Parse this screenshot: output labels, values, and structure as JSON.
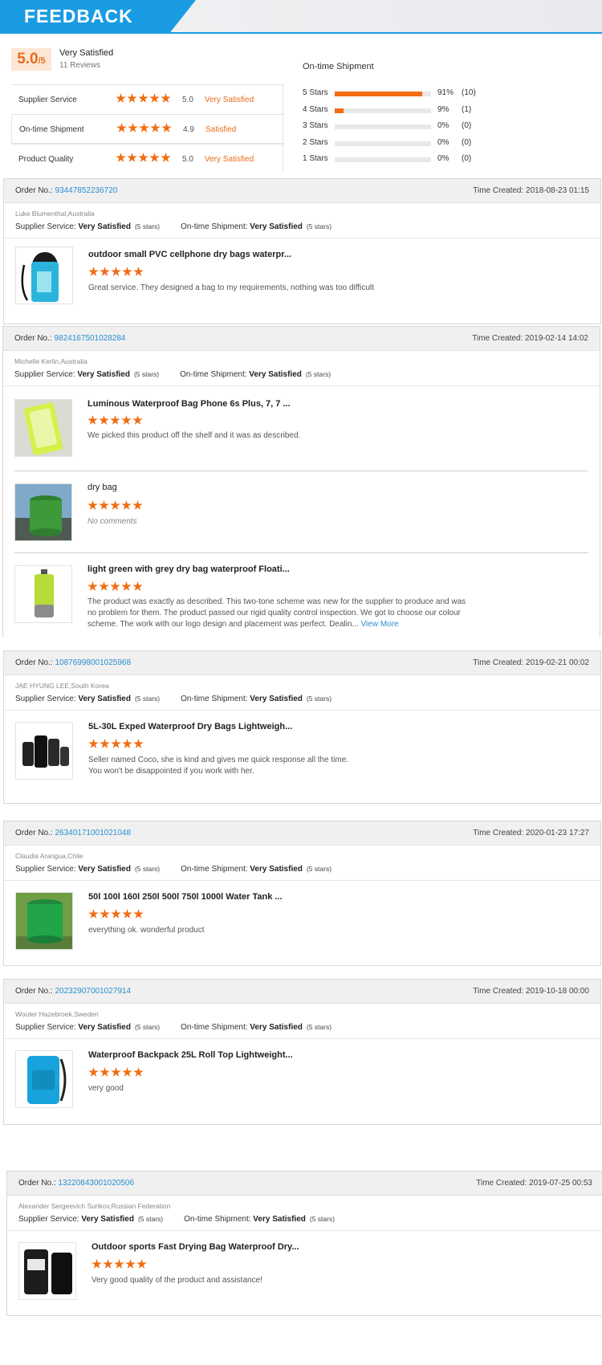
{
  "header": {
    "title": "FEEDBACK"
  },
  "summary": {
    "score": "5.0",
    "score_max": "/5",
    "label": "Very Satisfied",
    "reviews": "11 Reviews",
    "metrics": [
      {
        "name": "Supplier Service",
        "stars": 5,
        "value": "5.0",
        "text": "Very Satisfied"
      },
      {
        "name": "On-time Shipment",
        "stars": 5,
        "value": "4.9",
        "text": "Satisfied"
      },
      {
        "name": "Product Quality",
        "stars": 5,
        "value": "5.0",
        "text": "Very Satisfied"
      }
    ],
    "distribution_title": "On-time Shipment",
    "distribution": [
      {
        "label": "5  Stars",
        "fraction": 0.91,
        "pct": "91%",
        "count": "(10)"
      },
      {
        "label": "4  Stars",
        "fraction": 0.09,
        "pct": "9%",
        "count": "(1)"
      },
      {
        "label": "3  Stars",
        "fraction": 0,
        "pct": "0%",
        "count": "(0)"
      },
      {
        "label": "2  Stars",
        "fraction": 0,
        "pct": "0%",
        "count": "(0)"
      },
      {
        "label": "1  Stars",
        "fraction": 0,
        "pct": "0%",
        "count": "(0)"
      }
    ]
  },
  "labels": {
    "order_no": "Order No.:",
    "time_created": "Time Created:",
    "supplier_service": "Supplier Service:",
    "ontime_shipment": "On-time Shipment:",
    "rating_text": "Very Satisfied",
    "rating_stars": "(5 stars)",
    "view_more": "View More"
  },
  "orders": [
    {
      "order_no": "93447852236720",
      "time": "2018-08-23 01:15",
      "user": "Luke Blumenthal,Australia",
      "items": [
        {
          "title": "outdoor small PVC cellphone dry bags waterpr...",
          "comment": "Great service. They designed a bag to my requirements, nothing was too difficult"
        }
      ]
    },
    {
      "order_no": "9824167501028284",
      "time": "2019-02-14 14:02",
      "user": "Michelle Kerlin,Australia",
      "items": [
        {
          "title": "Luminous Waterproof Bag Phone 6s Plus, 7, 7 ...",
          "comment": "We picked this product off the shelf and it was as described."
        },
        {
          "title": "dry bag",
          "comment": "No comments"
        },
        {
          "title": "light green with grey dry bag waterproof Floati...",
          "comment": "The product was exactly as described. This two-tone scheme was new for the supplier to produce and was no problem for them. The product passed our rigid quality control inspection. We got to choose our colour scheme. The work with our logo design and placement was perfect. Dealin..."
        }
      ]
    },
    {
      "order_no": "10876998001025968",
      "time": "2019-02-21 00:02",
      "user": "JAE HYUNG LEE,South Korea",
      "items": [
        {
          "title": "5L-30L Exped Waterproof Dry Bags Lightweigh...",
          "comment_lines": [
            "Seller named Coco, she is kind and gives me quick response all the time.",
            "You won't be disappointed if you work with her."
          ]
        }
      ]
    },
    {
      "order_no": "26340171001021048",
      "time": "2020-01-23 17:27",
      "user": "Claudia Arangua,Chile",
      "items": [
        {
          "title": "50l 100l 160l 250l 500l 750l 1000l Water Tank ...",
          "comment": "everything ok. wonderful product"
        }
      ]
    },
    {
      "order_no": "20232907001027914",
      "time": "2019-10-18 00:00",
      "user": "Wouter Hazebroek,Sweden",
      "items": [
        {
          "title": "Waterproof Backpack 25L Roll Top Lightweight...",
          "comment": "very good"
        }
      ]
    },
    {
      "order_no": "13220843001020506",
      "time": "2019-07-25 00:53",
      "user": "Alexander Sergeevich Surikov,Russian Federation",
      "items": [
        {
          "title": "Outdoor sports Fast Drying Bag Waterproof Dry...",
          "comment": "Very good quality of the product and assistance!"
        }
      ]
    }
  ],
  "thumb_icons": [
    "blue-dry-bag-icon",
    "phone-pouch-icon",
    "green-dry-bag-icon",
    "lime-dry-bag-icon",
    "black-dry-bags-icon",
    "green-water-tank-icon",
    "blue-backpack-icon",
    "black-bag-icon"
  ],
  "colors": {
    "accent": "#1a9ce3",
    "star": "#f06d12",
    "link": "#2a8ed0",
    "satisfied": "#e76c18"
  }
}
